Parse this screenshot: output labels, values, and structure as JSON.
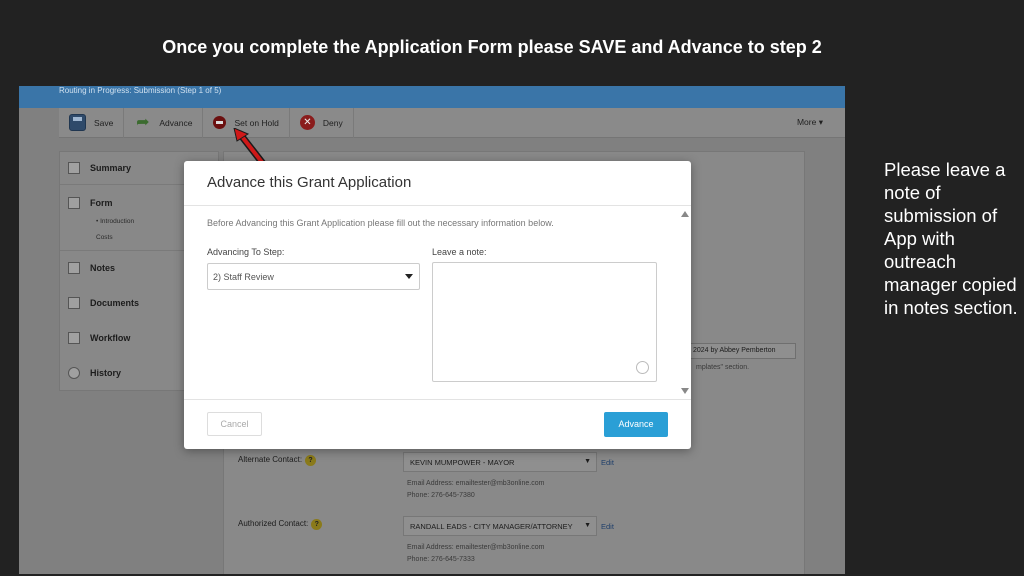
{
  "slide": {
    "title": "Once you complete the Application Form please SAVE and Advance to step 2",
    "side_note": "Please leave a note of submission of App with outreach manager copied in notes section."
  },
  "app": {
    "routing_status": "Routing in Progress: Submission (Step 1 of 5)",
    "toolbar": {
      "save": "Save",
      "advance": "Advance",
      "set_on_hold": "Set on Hold",
      "deny": "Deny",
      "more": "More"
    },
    "nav": {
      "summary": "Summary",
      "form": "Form",
      "form_sub_1": "Introduction",
      "form_sub_2": "Costs",
      "notes": "Notes",
      "documents": "Documents",
      "workflow": "Workflow",
      "history": "History"
    },
    "background_form": {
      "date_author": "2024 by Abbey Pemberton",
      "templates_hint": "mplates\" section.",
      "alternate_contact_label": "Alternate Contact:",
      "alternate_contact_value": "KEVIN MUMPOWER - MAYOR",
      "alternate_email": "Email Address: emailtester@mb3online.com",
      "alternate_phone": "Phone: 276-645-7380",
      "authorized_contact_label": "Authorized Contact:",
      "authorized_contact_value": "RANDALL EADS - CITY MANAGER/ATTORNEY",
      "authorized_email": "Email Address: emailtester@mb3online.com",
      "authorized_phone": "Phone: 276-645-7333",
      "edit": "Edit",
      "help": "?"
    }
  },
  "modal": {
    "title": "Advance this Grant Application",
    "description": "Before Advancing this Grant Application please fill out the necessary information below.",
    "step_label": "Advancing To Step:",
    "step_value": "2) Staff Review",
    "note_label": "Leave a note:",
    "note_value": "",
    "cancel": "Cancel",
    "advance": "Advance"
  },
  "colors": {
    "accent": "#2a9fd6",
    "arrow": "#d01818",
    "routing_bar": "#3a75a8"
  }
}
